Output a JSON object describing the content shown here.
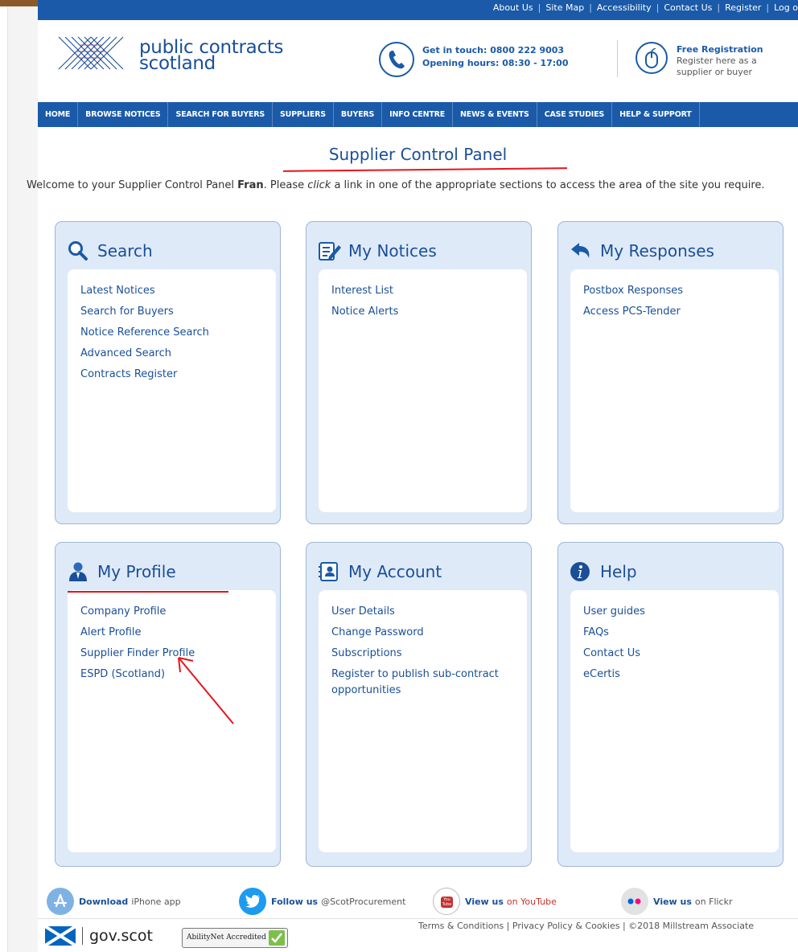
{
  "utility_bar": {
    "links": [
      "About Us",
      "Site Map",
      "Accessibility",
      "Contact Us",
      "Register",
      "Log o"
    ]
  },
  "header": {
    "logo_line1": "public contracts",
    "logo_line2": "scotland",
    "contact_line1": "Get in touch: 0800 222 9003",
    "contact_line2": "Opening hours: 08:30 - 17:00",
    "registration_title": "Free Registration",
    "registration_line1": "Register here as a",
    "registration_line2": "supplier or buyer"
  },
  "nav": {
    "items": [
      "HOME",
      "BROWSE NOTICES",
      "SEARCH FOR BUYERS",
      "SUPPLIERS",
      "BUYERS",
      "INFO CENTRE",
      "NEWS & EVENTS",
      "CASE STUDIES",
      "HELP & SUPPORT"
    ]
  },
  "page": {
    "title": "Supplier Control Panel",
    "welcome_pre": "Welcome to your Supplier Control Panel ",
    "welcome_name": "Fran",
    "welcome_mid": ". Please ",
    "welcome_click": "click",
    "welcome_post": " a link in one of the appropriate sections to access the area of the site you require."
  },
  "panels": [
    {
      "title": "Search",
      "icon": "search-icon",
      "links": [
        "Latest Notices",
        "Search for Buyers",
        "Notice Reference Search",
        "Advanced Search",
        "Contracts Register"
      ]
    },
    {
      "title": "My Notices",
      "icon": "notices-icon",
      "links": [
        "Interest List",
        "Notice Alerts"
      ]
    },
    {
      "title": "My Responses",
      "icon": "reply-icon",
      "links": [
        "Postbox Responses",
        "Access PCS-Tender"
      ]
    },
    {
      "title": "My Profile",
      "icon": "profile-icon",
      "links": [
        "Company Profile",
        "Alert Profile",
        "Supplier Finder Profile",
        "ESPD (Scotland)"
      ]
    },
    {
      "title": "My Account",
      "icon": "account-icon",
      "links": [
        "User Details",
        "Change Password",
        "Subscriptions",
        "Register to publish sub-contract opportunities"
      ]
    },
    {
      "title": "Help",
      "icon": "info-icon",
      "links": [
        "User guides",
        "FAQs",
        "Contact Us",
        "eCertis"
      ]
    }
  ],
  "footer": {
    "iphone_bold": "Download",
    "iphone_rest": "iPhone app",
    "twitter_bold": "Follow us",
    "twitter_rest": "@ScotProcurement",
    "youtube_bold": "View us",
    "youtube_rest": "on YouTube",
    "flickr_bold": "View us",
    "flickr_rest": "on Flickr",
    "govscot": "gov.scot",
    "abilitynet": "AbilityNet Accredited",
    "legal": "Terms & Conditions | Privacy Policy & Cookies | ©2018 Millstream Associate"
  },
  "colors": {
    "brand_blue": "#1a5aa8",
    "panel_bg": "#dfeaf8",
    "annotation_red": "#e8141c"
  }
}
